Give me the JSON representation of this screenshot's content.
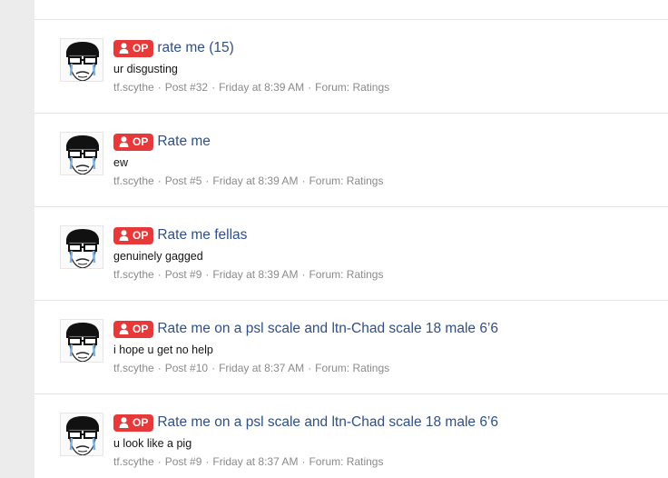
{
  "badge_label": "OP",
  "colors": {
    "badge": "#e8393a",
    "title": "#2f4f86",
    "meta": "#8a8a8a"
  },
  "icons": {
    "badge_icon": "user-icon",
    "avatar": "crying-glasses-face-avatar"
  },
  "results": [
    {
      "title": "rate me (15)",
      "snippet": "ur disgusting",
      "author": "tf.scythe",
      "post": "Post #32",
      "time": "Friday at 8:39 AM",
      "forum": "Forum: Ratings"
    },
    {
      "title": "Rate me",
      "snippet": "ew",
      "author": "tf.scythe",
      "post": "Post #5",
      "time": "Friday at 8:39 AM",
      "forum": "Forum: Ratings"
    },
    {
      "title": "Rate me fellas",
      "snippet": "genuinely gagged",
      "author": "tf.scythe",
      "post": "Post #9",
      "time": "Friday at 8:39 AM",
      "forum": "Forum: Ratings"
    },
    {
      "title": "Rate me on a psl scale and ltn-Chad scale 18 male 6’6",
      "snippet": "i hope u get no help",
      "author": "tf.scythe",
      "post": "Post #10",
      "time": "Friday at 8:37 AM",
      "forum": "Forum: Ratings"
    },
    {
      "title": "Rate me on a psl scale and ltn-Chad scale 18 male 6’6",
      "snippet": "u look like a pig",
      "author": "tf.scythe",
      "post": "Post #9",
      "time": "Friday at 8:37 AM",
      "forum": "Forum: Ratings"
    }
  ]
}
